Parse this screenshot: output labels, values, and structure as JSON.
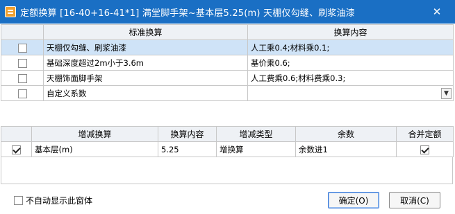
{
  "window": {
    "title": "定额换算 [16-40+16-41*1] 满堂脚手架~基本层5.25(m) 天棚仅勾缝、刷浆油漆",
    "close_label": "✕"
  },
  "standard_table": {
    "headers": {
      "name": "标准换算",
      "content": "换算内容"
    },
    "rows": [
      {
        "checked": false,
        "name": "天棚仅勾缝、刷浆油漆",
        "content": "人工乘0.4;材料乘0.1;",
        "selected": true
      },
      {
        "checked": false,
        "name": "基础深度超过2m小于3.6m",
        "content": "基价乘0.6;",
        "selected": false
      },
      {
        "checked": false,
        "name": "天棚饰面脚手架",
        "content": "人工费乘0.6;材料费乘0.3;",
        "selected": false
      },
      {
        "checked": false,
        "name": "自定义系数",
        "content": "",
        "selected": false,
        "dropdown": "▼"
      }
    ]
  },
  "incdec_table": {
    "headers": {
      "name": "增减换算",
      "content": "换算内容",
      "type": "增减类型",
      "remainder": "余数",
      "merge": "合并定额"
    },
    "rows": [
      {
        "checked": true,
        "name": "基本层(m)",
        "content": "5.25",
        "type": "增换算",
        "remainder": "余数进1",
        "merge": true
      }
    ]
  },
  "footer": {
    "no_auto_show_label": "不自动显示此窗体",
    "no_auto_show_checked": false,
    "ok_label": "确定(O)",
    "cancel_label": "取消(C)"
  }
}
